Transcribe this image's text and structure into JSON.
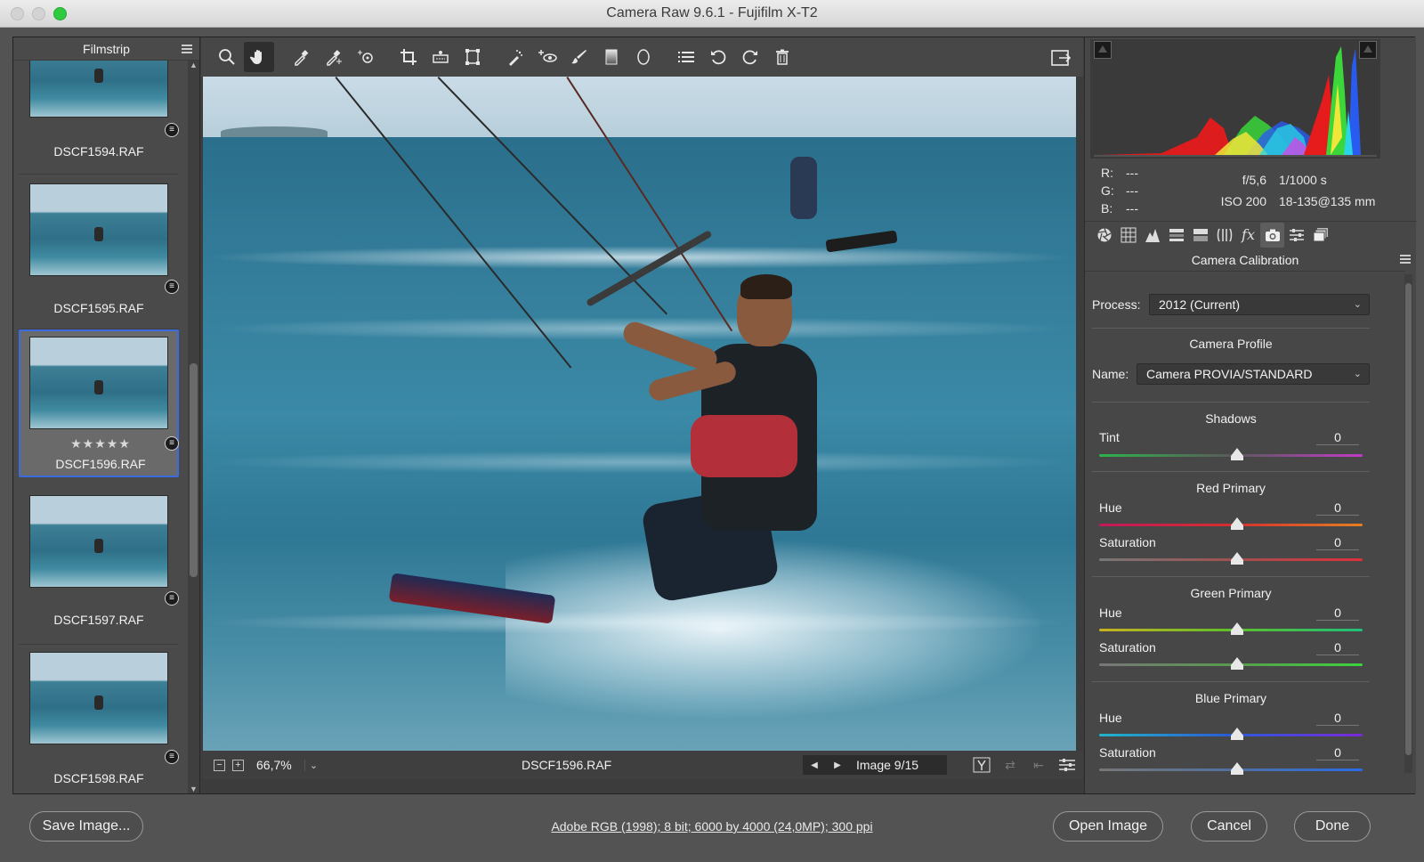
{
  "window": {
    "title": "Camera Raw 9.6.1  -  Fujifilm X-T2"
  },
  "filmstrip": {
    "header": "Filmstrip",
    "items": [
      {
        "name": "DSCF1594.RAF",
        "stars": "",
        "selected": false
      },
      {
        "name": "DSCF1595.RAF",
        "stars": "",
        "selected": false
      },
      {
        "name": "DSCF1596.RAF",
        "stars": "★★★★★",
        "selected": true
      },
      {
        "name": "DSCF1597.RAF",
        "stars": "",
        "selected": false
      },
      {
        "name": "DSCF1598.RAF",
        "stars": "",
        "selected": false
      }
    ]
  },
  "toolbar": {
    "tools": [
      {
        "name": "zoom-tool",
        "icon": "magnifier"
      },
      {
        "name": "hand-tool",
        "icon": "hand",
        "active": true
      },
      {
        "name": "white-balance-tool",
        "icon": "eyedropper"
      },
      {
        "name": "color-sampler-tool",
        "icon": "eyedropper-plus"
      },
      {
        "name": "targeted-adjustment-tool",
        "icon": "target"
      },
      {
        "name": "crop-tool",
        "icon": "crop"
      },
      {
        "name": "straighten-tool",
        "icon": "level"
      },
      {
        "name": "transform-tool",
        "icon": "transform"
      },
      {
        "name": "spot-removal-tool",
        "icon": "brush-spot"
      },
      {
        "name": "red-eye-tool",
        "icon": "eye"
      },
      {
        "name": "adjustment-brush-tool",
        "icon": "brush"
      },
      {
        "name": "graduated-filter-tool",
        "icon": "gradient"
      },
      {
        "name": "radial-filter-tool",
        "icon": "ellipse"
      },
      {
        "name": "preferences-tool",
        "icon": "list"
      },
      {
        "name": "rotate-left-tool",
        "icon": "rotate-ccw"
      },
      {
        "name": "rotate-right-tool",
        "icon": "rotate-cw"
      },
      {
        "name": "trash-tool",
        "icon": "trash"
      }
    ]
  },
  "image_status": {
    "zoom": "66,7%",
    "filename": "DSCF1596.RAF",
    "image_count": "Image 9/15"
  },
  "histogram_info": {
    "r": "---",
    "g": "---",
    "b": "---",
    "aperture": "f/5,6",
    "shutter": "1/1000 s",
    "iso": "ISO 200",
    "lens": "18-135@135 mm"
  },
  "panel": {
    "title": "Camera Calibration",
    "process_label": "Process:",
    "process_value": "2012 (Current)",
    "camera_profile_title": "Camera Profile",
    "name_label": "Name:",
    "name_value": "Camera PROVIA/STANDARD",
    "shadows": {
      "title": "Shadows",
      "tint_label": "Tint",
      "tint_value": "0"
    },
    "red_primary": {
      "title": "Red Primary",
      "hue_label": "Hue",
      "hue_value": "0",
      "sat_label": "Saturation",
      "sat_value": "0"
    },
    "green_primary": {
      "title": "Green Primary",
      "hue_label": "Hue",
      "hue_value": "0",
      "sat_label": "Saturation",
      "sat_value": "0"
    },
    "blue_primary": {
      "title": "Blue Primary",
      "hue_label": "Hue",
      "hue_value": "0",
      "sat_label": "Saturation",
      "sat_value": "0"
    }
  },
  "bottom": {
    "save_label": "Save Image...",
    "workflow_options": "Adobe RGB (1998); 8 bit; 6000 by 4000 (24,0MP); 300 ppi",
    "open_label": "Open Image",
    "cancel_label": "Cancel",
    "done_label": "Done"
  },
  "colors": {
    "accent_selection": "#3d6ce0",
    "panel_bg": "#474747",
    "app_bg": "#535353"
  }
}
